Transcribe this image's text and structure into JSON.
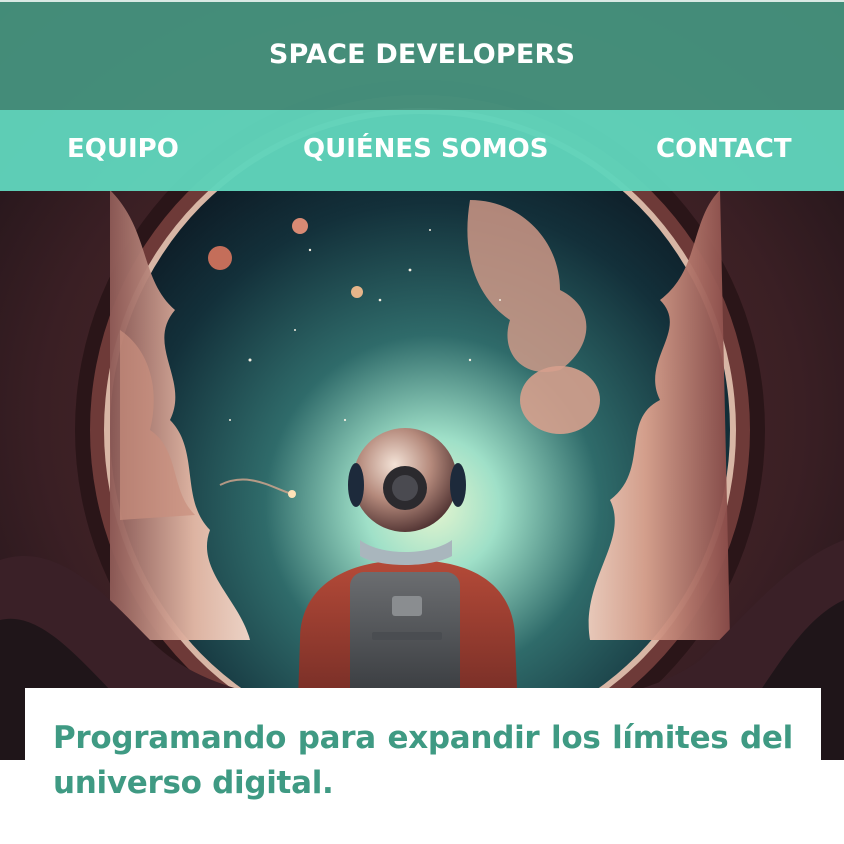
{
  "header": {
    "brand": "SPACE DEVELOPERS"
  },
  "nav": {
    "items": [
      {
        "label": "EQUIPO"
      },
      {
        "label": "QUIÉNES SOMOS"
      },
      {
        "label": "CONTACT"
      }
    ]
  },
  "hero": {
    "image_subject": "astronaut looking through a round porthole into space"
  },
  "tagline": {
    "text": "Programando para expandir los límites del universo digital."
  },
  "colors": {
    "topbar": "#46927d",
    "navbar": "#60d4bb",
    "tagline_text": "#3f9a83"
  }
}
